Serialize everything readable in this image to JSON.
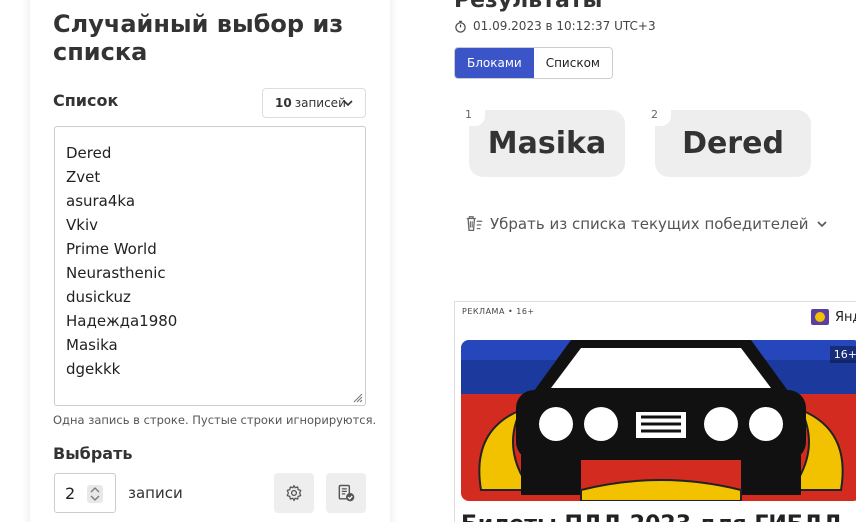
{
  "left_panel": {
    "title": "Случайный выбор из списка",
    "list_label": "Список",
    "count_select": {
      "number": "10",
      "unit": "записей"
    },
    "entries": [
      "Dered",
      "Zvet",
      "asura4ka",
      "Vkiv",
      "Prime World",
      "Neurasthenic",
      "dusickuz",
      "Надежда1980",
      "Masika",
      "dgekkk"
    ],
    "hint": "Одна запись в строке. Пустые строки игнорируются.",
    "pick_label": "Выбрать",
    "pick_value": "2",
    "pick_unit": "записи",
    "settings_icon": "gear-icon",
    "clear_icon": "document-check-icon"
  },
  "results": {
    "title": "Результаты",
    "timestamp": "01.09.2023 в 10:12:37 UTC+3",
    "view_toggle": {
      "blocks": "Блоками",
      "list": "Списком"
    },
    "winners": [
      {
        "num": "1",
        "name": "Masika"
      },
      {
        "num": "2",
        "name": "Dered"
      }
    ],
    "remove_label": "Убрать из списка текущих победителей"
  },
  "ad": {
    "label": "РЕКЛАМА • 16+",
    "brand": "Янд",
    "age": "16+",
    "headline": "Билеты ПДД 2023 для ГИБДД",
    "colors": {
      "blue": "#1c3a9e",
      "red": "#d32b1f",
      "gold": "#f2c200"
    }
  },
  "colors": {
    "accent": "#3b55c9"
  }
}
